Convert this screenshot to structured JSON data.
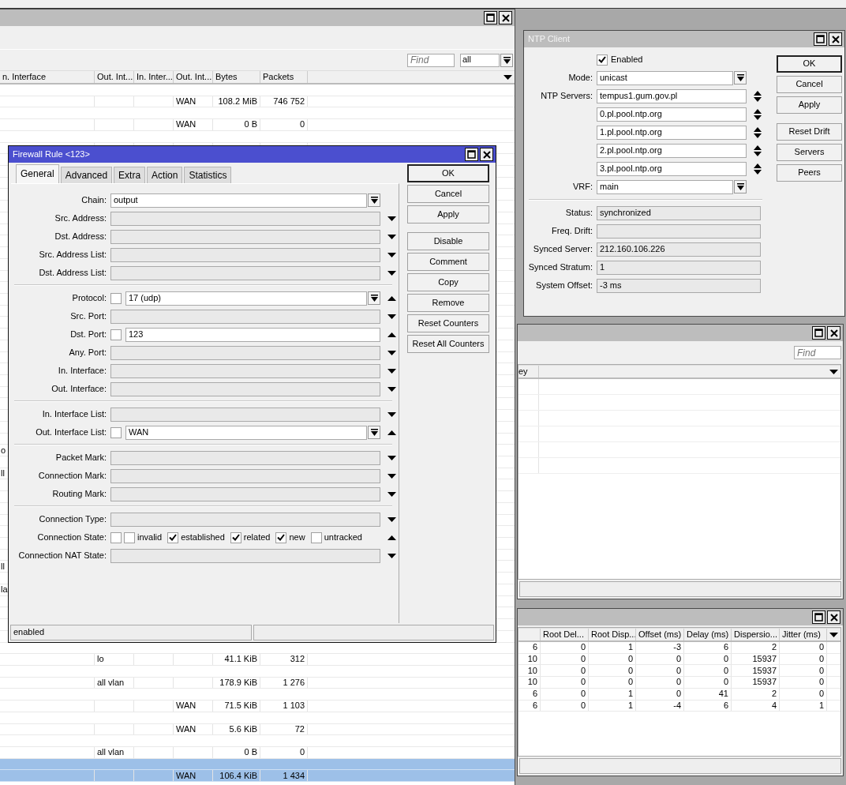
{
  "rules_window": {
    "find": {
      "placeholder": "Find"
    },
    "filter": {
      "value": "all"
    },
    "columns": [
      "n. Interface",
      "Out. Int...",
      "In. Inter...",
      "Out. Int...",
      "Bytes",
      "Packets"
    ],
    "rules": [
      {
        "selected": false,
        "column_4": "WAN",
        "column_5": "108.2 MiB",
        "column_6": "746 752"
      },
      {
        "selected": false,
        "column_4": "WAN",
        "column_5": "0 B",
        "column_6": "0"
      },
      {
        "selected": false
      },
      {
        "selected": false
      },
      {
        "selected": false
      },
      {
        "selected": false
      },
      {
        "selected": false
      },
      {
        "selected": false
      },
      {
        "selected": false
      },
      {
        "selected": false
      },
      {
        "selected": false
      },
      {
        "selected": false
      },
      {
        "selected": false
      },
      {
        "selected": false
      },
      {
        "selected": false
      },
      {
        "selected": false,
        "column_1": "o"
      },
      {
        "selected": false,
        "column_1": "ll"
      },
      {
        "selected": false
      },
      {
        "selected": false
      },
      {
        "selected": false
      },
      {
        "selected": false,
        "column_1": "ll"
      },
      {
        "selected": false,
        "column_1": "la"
      },
      {
        "selected": false
      },
      {
        "selected": false
      },
      {
        "selected": false,
        "column_2": "lo",
        "column_5": "41.1 KiB",
        "column_6": "312"
      },
      {
        "selected": false,
        "column_2": "all vlan",
        "column_5": "178.9 KiB",
        "column_6": "1 276"
      },
      {
        "selected": false,
        "column_4": "WAN",
        "column_5": "71.5 KiB",
        "column_6": "1 103"
      },
      {
        "selected": false,
        "column_4": "WAN",
        "column_5": "5.6 KiB",
        "column_6": "72"
      },
      {
        "selected": false,
        "column_2": "all vlan",
        "column_5": "0 B",
        "column_6": "0"
      },
      {
        "selected": true,
        "column_4": "WAN",
        "column_5": "106.4 KiB",
        "column_6": "1 434"
      }
    ]
  },
  "firewall_rule_dialog": {
    "title": "Firewall Rule <123>",
    "tabs": [
      {
        "label": "General",
        "selected": true
      },
      {
        "label": "Advanced",
        "selected": false
      },
      {
        "label": "Extra",
        "selected": false
      },
      {
        "label": "Action",
        "selected": false
      },
      {
        "label": "Statistics",
        "selected": false
      }
    ],
    "groups": [
      [
        {
          "label": "Chain:",
          "kind": "combo",
          "value": "output"
        },
        {
          "label": "Src. Address:",
          "kind": "text",
          "expanded": false
        },
        {
          "label": "Dst. Address:",
          "kind": "text",
          "expanded": false
        },
        {
          "label": "Src. Address List:",
          "kind": "text",
          "expanded": false
        },
        {
          "label": "Dst. Address List:",
          "kind": "text",
          "expanded": false
        }
      ],
      [
        {
          "label": "Protocol:",
          "kind": "combo",
          "negated": false,
          "value": "17 (udp)",
          "expanded": true
        },
        {
          "label": "Src. Port:",
          "kind": "text",
          "expanded": false
        },
        {
          "label": "Dst. Port:",
          "kind": "text",
          "negated": false,
          "value": "123",
          "expanded": true
        },
        {
          "label": "Any. Port:",
          "kind": "text",
          "expanded": false
        },
        {
          "label": "In. Interface:",
          "kind": "text",
          "expanded": false
        },
        {
          "label": "Out. Interface:",
          "kind": "text",
          "expanded": false
        }
      ],
      [
        {
          "label": "In. Interface List:",
          "kind": "text",
          "expanded": false
        },
        {
          "label": "Out. Interface List:",
          "kind": "combo",
          "negated": false,
          "value": "WAN",
          "expanded": true
        }
      ],
      [
        {
          "label": "Packet Mark:",
          "kind": "text",
          "expanded": false
        },
        {
          "label": "Connection Mark:",
          "kind": "text",
          "expanded": false
        },
        {
          "label": "Routing Mark:",
          "kind": "text",
          "expanded": false
        }
      ],
      [
        {
          "label": "Connection Type:",
          "kind": "text",
          "expanded": false
        },
        {
          "label": "Connection State:",
          "kind": "states",
          "negated": false,
          "expanded": true,
          "options": [
            {
              "label": "invalid",
              "checked": false
            },
            {
              "label": "established",
              "checked": true
            },
            {
              "label": "related",
              "checked": true
            },
            {
              "label": "new",
              "checked": true
            },
            {
              "label": "untracked",
              "checked": false
            }
          ]
        },
        {
          "label": "Connection NAT State:",
          "kind": "text",
          "expanded": false
        }
      ]
    ],
    "button_groups": [
      [
        {
          "label": "OK",
          "default": true
        },
        {
          "label": "Cancel",
          "default": false
        },
        {
          "label": "Apply",
          "default": false
        }
      ],
      [
        {
          "label": "Disable",
          "default": false
        },
        {
          "label": "Comment",
          "default": false
        },
        {
          "label": "Copy",
          "default": false
        },
        {
          "label": "Remove",
          "default": false
        },
        {
          "label": "Reset Counters",
          "default": false
        },
        {
          "label": "Reset All Counters",
          "default": false
        }
      ]
    ],
    "status_bar": {
      "state": "enabled"
    }
  },
  "ntp_client": {
    "title": "NTP Client",
    "enabled": {
      "label": "Enabled",
      "checked": true
    },
    "mode": {
      "label": "Mode:",
      "value": "unicast"
    },
    "servers": {
      "label": "NTP Servers:",
      "values": [
        "tempus1.gum.gov.pl",
        "0.pl.pool.ntp.org",
        "1.pl.pool.ntp.org",
        "2.pl.pool.ntp.org",
        "3.pl.pool.ntp.org"
      ]
    },
    "vrf": {
      "label": "VRF:",
      "value": "main"
    },
    "status_fields": [
      {
        "label": "Status:",
        "value": "synchronized"
      },
      {
        "label": "Freq. Drift:"
      },
      {
        "label": "Synced Server:",
        "value": "212.160.106.226"
      },
      {
        "label": "Synced Stratum:",
        "value": "1"
      },
      {
        "label": "System Offset:",
        "value": "-3 ms"
      }
    ],
    "button_groups": [
      [
        {
          "label": "OK",
          "default": true
        },
        {
          "label": "Cancel",
          "default": false
        },
        {
          "label": "Apply",
          "default": false
        }
      ],
      [
        {
          "label": "Reset Drift",
          "default": false
        },
        {
          "label": "Servers",
          "default": false
        },
        {
          "label": "Peers",
          "default": false
        }
      ]
    ]
  },
  "keys_window": {
    "find": {
      "placeholder": "Find"
    },
    "columns": [
      "ey"
    ]
  },
  "peers_window": {
    "columns": [
      "",
      "Root Del...",
      "Root Disp...",
      "Offset (ms)",
      "Delay (ms)",
      "Dispersio...",
      "Jitter (ms)"
    ],
    "rows": [
      [
        "6",
        "0",
        "1",
        "-3",
        "6",
        "2",
        "0"
      ],
      [
        "10",
        "0",
        "0",
        "0",
        "0",
        "15937",
        "0"
      ],
      [
        "10",
        "0",
        "0",
        "0",
        "0",
        "15937",
        "0"
      ],
      [
        "10",
        "0",
        "0",
        "0",
        "0",
        "15937",
        "0"
      ],
      [
        "6",
        "0",
        "1",
        "0",
        "41",
        "2",
        "0"
      ],
      [
        "6",
        "0",
        "1",
        "-4",
        "6",
        "4",
        "1"
      ]
    ]
  }
}
